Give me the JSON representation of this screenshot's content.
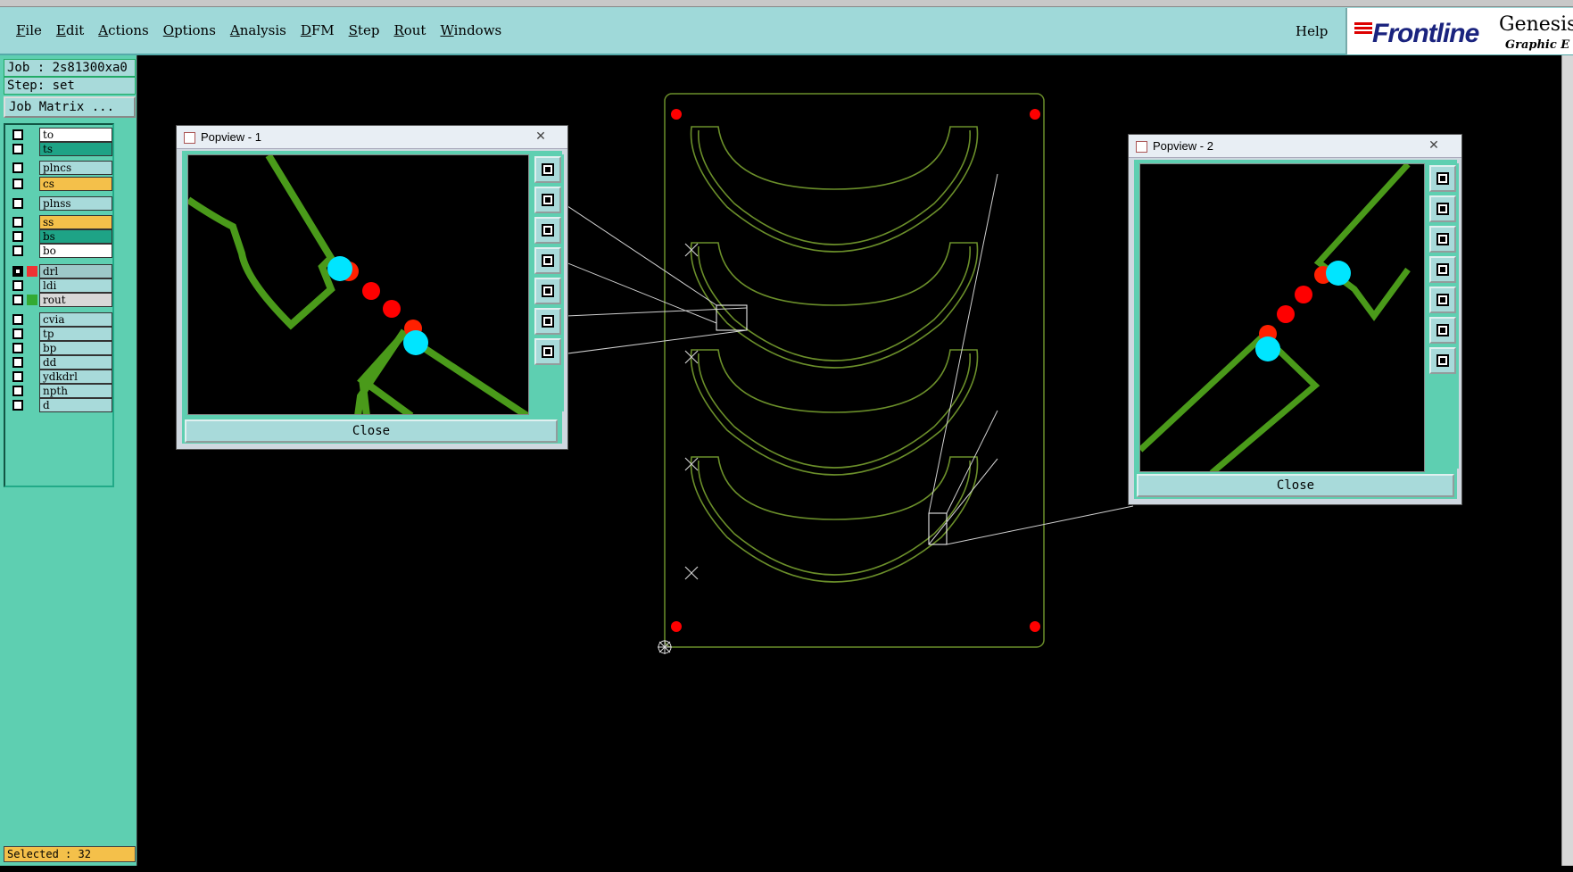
{
  "menu": {
    "items": [
      "File",
      "Edit",
      "Actions",
      "Options",
      "Analysis",
      "DFM",
      "Step",
      "Rout",
      "Windows"
    ],
    "help": "Help"
  },
  "brand": {
    "logo": "Frontline",
    "product": "Genesis",
    "subtitle": "Graphic E"
  },
  "sidebar": {
    "job": "Job : 2s81300xa0",
    "step": "Step: set",
    "job_matrix": "Job Matrix ...",
    "selected": "Selected : 32",
    "layers": [
      {
        "name": "to",
        "color": "#ffffff",
        "checked": false
      },
      {
        "name": "ts",
        "color": "#1ea386",
        "checked": false
      },
      {
        "name": "plncs",
        "color": "#a8dada",
        "checked": false
      },
      {
        "name": "cs",
        "color": "#f4c04a",
        "checked": false
      },
      {
        "name": "plnss",
        "color": "#a8dada",
        "checked": false
      },
      {
        "name": "ss",
        "color": "#f4c04a",
        "checked": false
      },
      {
        "name": "bs",
        "color": "#1ea386",
        "checked": false
      },
      {
        "name": "bo",
        "color": "#ffffff",
        "checked": false
      },
      {
        "name": "drl",
        "color": "#9ec8c8",
        "checked": true
      },
      {
        "name": "ldi",
        "color": "#a8dada",
        "checked": false
      },
      {
        "name": "rout",
        "color": "#d8d8d8",
        "checked": false
      },
      {
        "name": "cvia",
        "color": "#a8dada",
        "checked": false
      },
      {
        "name": "tp",
        "color": "#a8dada",
        "checked": false
      },
      {
        "name": "bp",
        "color": "#a8dada",
        "checked": false
      },
      {
        "name": "dd",
        "color": "#a8dada",
        "checked": false
      },
      {
        "name": "ydkdrl",
        "color": "#a8dada",
        "checked": false
      },
      {
        "name": "npth",
        "color": "#a8dada",
        "checked": false
      },
      {
        "name": "d",
        "color": "#a8dada",
        "checked": false
      }
    ]
  },
  "popview1": {
    "title": "Popview - 1",
    "close_label": "Close",
    "close_icon": "close-icon"
  },
  "popview2": {
    "title": "Popview - 2",
    "close_label": "Close",
    "close_icon": "close-icon"
  },
  "colors": {
    "board_outline": "#6b8f2a",
    "rout_path": "#4a9a1a",
    "pad_red": "#ff0000",
    "pad_cyan": "#00e5ff",
    "link_line": "#ffffff"
  }
}
